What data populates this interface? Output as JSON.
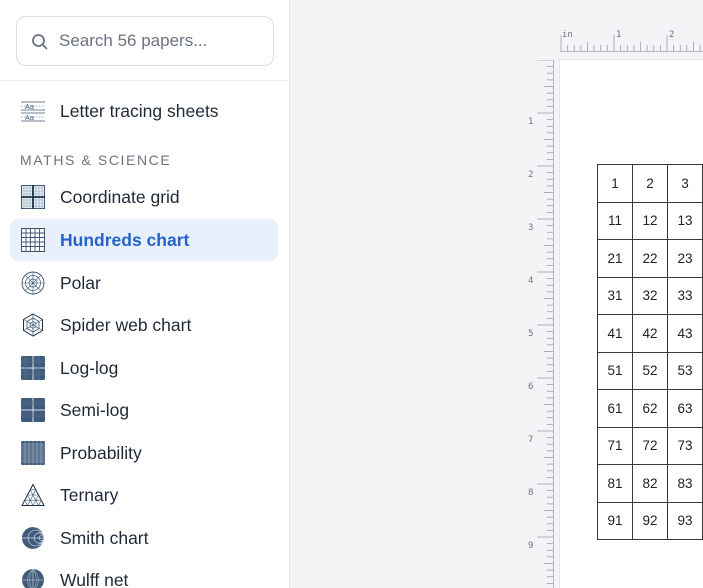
{
  "search": {
    "placeholder": "Search 56 papers..."
  },
  "sidebar": {
    "items": [
      {
        "label": "Letter tracing sheets",
        "icon": "letter-tracing-icon"
      },
      {
        "label": "Coordinate grid",
        "icon": "coordinate-grid-icon"
      },
      {
        "label": "Hundreds chart",
        "icon": "hundreds-chart-icon",
        "active": true
      },
      {
        "label": "Polar",
        "icon": "polar-icon"
      },
      {
        "label": "Spider web chart",
        "icon": "spider-web-icon"
      },
      {
        "label": "Log-log",
        "icon": "log-log-icon"
      },
      {
        "label": "Semi-log",
        "icon": "semi-log-icon"
      },
      {
        "label": "Probability",
        "icon": "probability-icon"
      },
      {
        "label": "Ternary",
        "icon": "ternary-icon"
      },
      {
        "label": "Smith chart",
        "icon": "smith-chart-icon"
      },
      {
        "label": "Wulff net",
        "icon": "wulff-net-icon"
      }
    ],
    "section": "MATHS & SCIENCE"
  },
  "ruler": {
    "unit": "in",
    "h_labels": [
      "1",
      "2"
    ],
    "v_labels": [
      "1",
      "2",
      "3",
      "4",
      "5",
      "6",
      "7",
      "8",
      "9"
    ]
  },
  "hundreds_chart": {
    "rows": [
      [
        "1",
        "2",
        "3"
      ],
      [
        "11",
        "12",
        "13"
      ],
      [
        "21",
        "22",
        "23"
      ],
      [
        "31",
        "32",
        "33"
      ],
      [
        "41",
        "42",
        "43"
      ],
      [
        "51",
        "52",
        "53"
      ],
      [
        "61",
        "62",
        "63"
      ],
      [
        "71",
        "72",
        "73"
      ],
      [
        "81",
        "82",
        "83"
      ],
      [
        "91",
        "92",
        "93"
      ]
    ]
  },
  "colors": {
    "accent": "#2563c9",
    "active_bg": "#e8f0fd",
    "icon": "#3b5573"
  }
}
